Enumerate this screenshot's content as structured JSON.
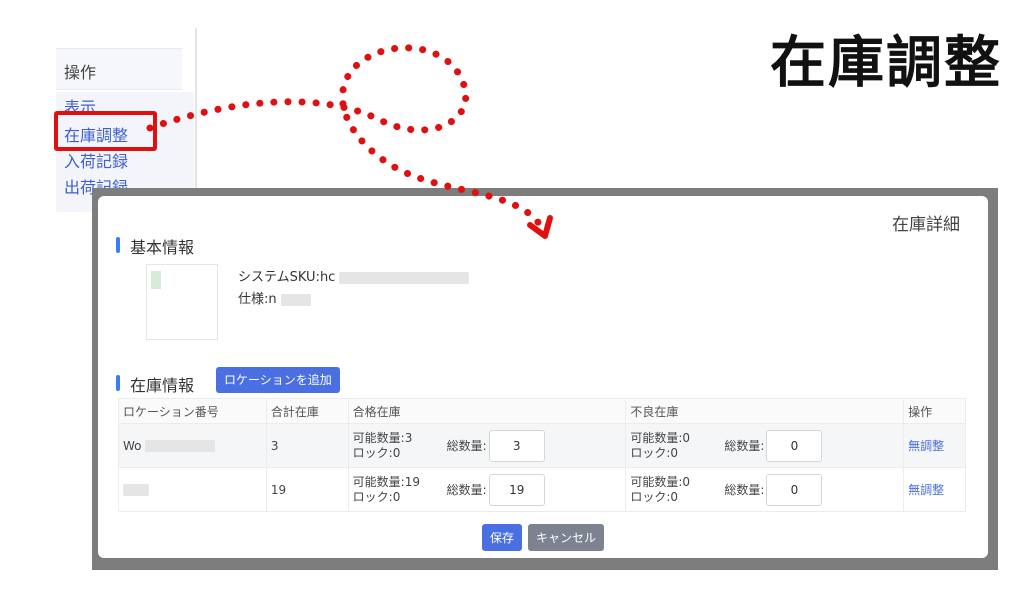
{
  "page_title": "在庫調整",
  "ops_column": {
    "header": "操作",
    "links": [
      "表示",
      "在庫調整",
      "入荷記録",
      "出荷記録"
    ]
  },
  "modal": {
    "title": "在庫詳細",
    "basic_section": "基本情報",
    "sku_label": "システムSKU:",
    "sku_value": "hc",
    "spec_label": "仕様:",
    "spec_value": "n",
    "stock_section": "在庫情報",
    "add_location_label": "ロケーションを追加",
    "columns": [
      "ロケーション番号",
      "合計在庫",
      "合格在庫",
      "不良在庫",
      "操作"
    ],
    "rows": [
      {
        "location": "Wo",
        "total": "3",
        "good_available": "可能数量:3",
        "good_lock": "ロック:0",
        "good_qty_label": "総数量:",
        "good_qty": "3",
        "bad_available": "可能数量:0",
        "bad_lock": "ロック:0",
        "bad_qty_label": "総数量:",
        "bad_qty": "0",
        "action": "無調整"
      },
      {
        "location": "",
        "total": "19",
        "good_available": "可能数量:19",
        "good_lock": "ロック:0",
        "good_qty_label": "総数量:",
        "good_qty": "19",
        "bad_available": "可能数量:0",
        "bad_lock": "ロック:0",
        "bad_qty_label": "総数量:",
        "bad_qty": "0",
        "action": "無調整"
      }
    ],
    "save_label": "保存",
    "cancel_label": "キャンセル"
  },
  "colors": {
    "accent": "#4a6fe3",
    "highlight": "#e01010",
    "arrow": "#e01010"
  }
}
